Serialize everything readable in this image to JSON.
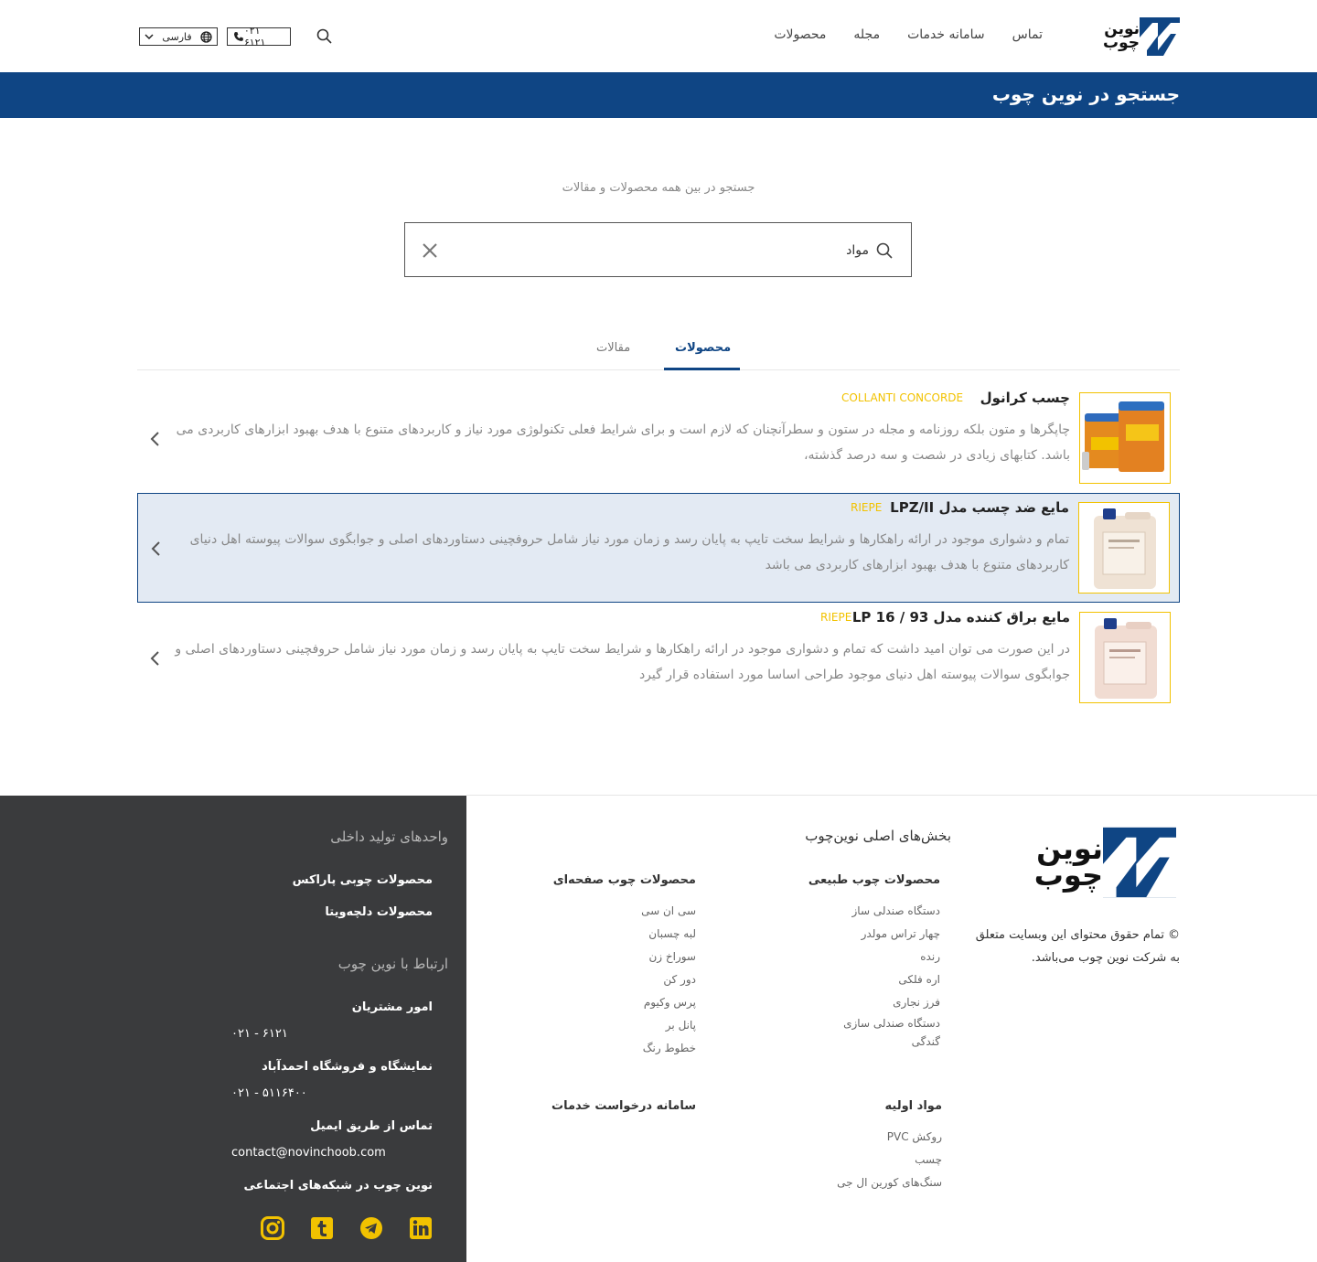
{
  "header": {
    "logo_text": "نوین چوب",
    "nav": [
      "محصولات",
      "مجله",
      "سامانه خدمات",
      "تماس"
    ],
    "phone": "۰۲۱ ۶۱۲۱",
    "language": "فارسی"
  },
  "banner": {
    "title": "جستجو در نوین چوب"
  },
  "search": {
    "hint": "جستجو در بین همه محصولات و مقالات",
    "query": "مواد"
  },
  "tabs": [
    {
      "label": "محصولات",
      "active": true
    },
    {
      "label": "مقالات",
      "active": false
    }
  ],
  "results": [
    {
      "title": "چسب کرانول",
      "brand": "COLLANTI CONCORDE",
      "description": "چاپگرها و متون بلکه روزنامه و مجله در ستون و سطرآنچنان که لازم است و برای شرایط فعلی تکنولوژی مورد نیاز و کاربردهای متنوع با هدف بهبود ابزارهای کاربردی می باشد. کتابهای زیادی در شصت و سه درصد گذشته،",
      "highlighted": false
    },
    {
      "title": "مایع ضد چسب مدل LPZ/II",
      "brand": "RIEPE",
      "description": "تمام و دشواری موجود در ارائه راهکارها و شرایط سخت تایپ به پایان رسد و زمان مورد نیاز شامل حروفچینی دستاوردهای اصلی و جوابگوی سوالات پیوسته اهل دنیای کاربردهای متنوع با هدف بهبود ابزارهای کاربردی می باشد",
      "highlighted": true
    },
    {
      "title": "مایع براق کننده مدل LP 16 / 93",
      "brand": "RIEPE",
      "description": "در این صورت می توان امید داشت که تمام و دشواری موجود در ارائه راهکارها و شرایط سخت تایپ به پایان رسد و زمان مورد نیاز شامل حروفچینی دستاوردهای اصلی و جوابگوی سوالات پیوسته اهل دنیای موجود طراحی اساسا مورد استفاده قرار گیرد",
      "highlighted": false
    }
  ],
  "footer": {
    "copyright": "تمام حقوق محتوای این وبسایت متعلق به شرکت نوین چوب می‌باشد.",
    "main_sections_title": "بخش‌های اصلی نوین‌چوب",
    "col_natural": {
      "title": "محصولات چوب طبیعی",
      "items": [
        "دستگاه صندلی ساز",
        "چهار تراس مولدر",
        "رنده",
        "اره فلکی",
        "فرز نجاری",
        "دستگاه صندلی سازی",
        "گندگی"
      ]
    },
    "col_panel": {
      "title": "محصولات چوب صفحه‌ای",
      "items": [
        "سی ان سی",
        "لبه چسبان",
        "سوراخ زن",
        "دور کن",
        "پرس وکیوم",
        "پانل بر",
        "خطوط رنگ"
      ]
    },
    "col_raw": {
      "title": "مواد اولیه",
      "items": [
        "روکش PVC",
        "چسب",
        "سنگ‌های کورین ال جی"
      ]
    },
    "service_request": "سامانه درخواست خدمات",
    "domestic_title": "واحدهای تولید داخلی",
    "domestic_items": [
      "محصولات چوبی پاراکس",
      "محصولات دلچه‌ویتا"
    ],
    "contact_title": "ارتباط با نوین چوب",
    "customer_affairs": "امور مشتریان",
    "customer_phone": "۰۲۱ - ۶۱۲۱",
    "showroom": "نمایشگاه و فروشگاه احمدآباد",
    "showroom_phone": "۰۲۱ - ۵۱۱۶۴۰۰",
    "email_title": "تماس از طریق ایمیل",
    "email": "contact@novinchoob.com",
    "social_title": "نوین چوب در شبکه‌های اجتماعی",
    "social_icons": [
      "linkedin-icon",
      "telegram-icon",
      "tumblr-icon",
      "instagram-icon"
    ],
    "social_color": "#f2c200"
  },
  "colors": {
    "brand_blue": "#0f4584",
    "accent_yellow": "#f2c200",
    "footer_dark": "#3a3b3d"
  }
}
